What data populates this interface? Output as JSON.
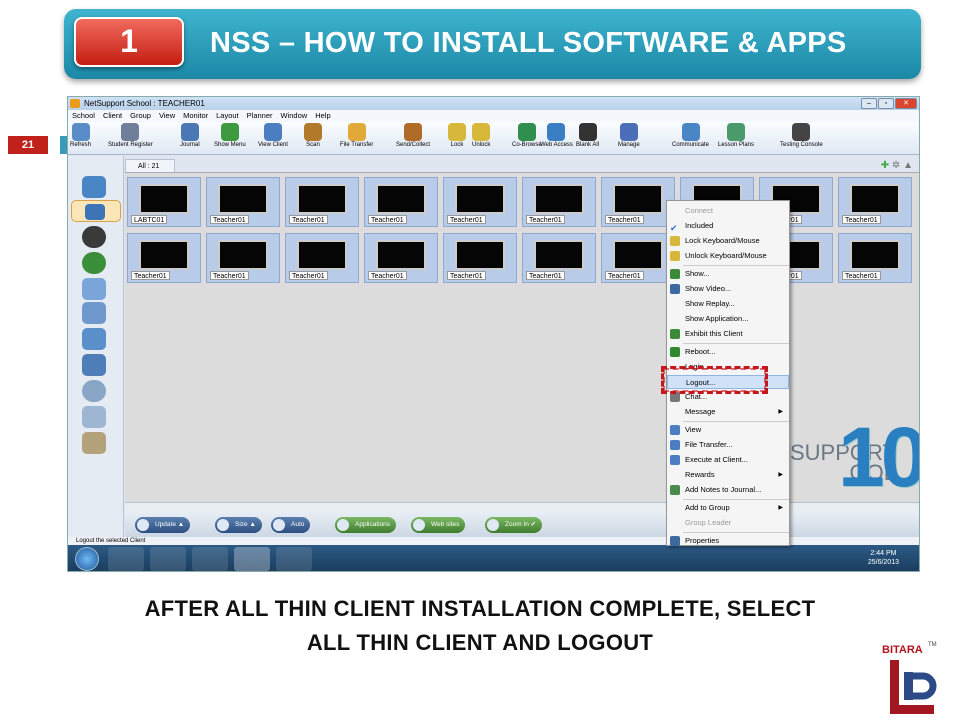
{
  "slide": {
    "number": "1",
    "title": "NSS – HOW TO INSTALL SOFTWARE & APPS",
    "page": "21",
    "caption_line1": "AFTER ALL THIN CLIENT INSTALLATION COMPLETE, SELECT",
    "caption_line2": "ALL THIN CLIENT AND LOGOUT",
    "brand": "BITARA",
    "brand_tm": "TM"
  },
  "app": {
    "title": "NetSupport School : TEACHER01",
    "menu": [
      "School",
      "Client",
      "Group",
      "View",
      "Monitor",
      "Layout",
      "Planner",
      "Window",
      "Help"
    ],
    "toolbar": [
      "Refresh",
      "Student Register",
      "Journal",
      "Show Menu",
      "View Client",
      "Scan",
      "File Transfer",
      "Send/Collect",
      "Lock",
      "Unlock",
      "Co-Browse",
      "Web Access",
      "Blank All",
      "Manage",
      "Communicate",
      "Lesson Plans",
      "Testing Console"
    ],
    "tab": "All : 21",
    "clients_row1": [
      "LABTC01",
      "Teacher01",
      "Teacher01",
      "Teacher01",
      "Teacher01",
      "Teacher01",
      "Teacher01",
      "Teacher01",
      "Teacher01",
      "Teacher01"
    ],
    "clients_row2": [
      "Teacher01",
      "Teacher01",
      "Teacher01",
      "Teacher01",
      "Teacher01",
      "Teacher01",
      "Teacher01",
      "Teacher01",
      "Teacher01",
      "Teacher01"
    ],
    "bottom_buttons": [
      "Update",
      "Size",
      "Auto",
      "Applications",
      "Web sites",
      "Zoom In"
    ],
    "status": "Logout the selected Client",
    "clock_time": "2:44 PM",
    "clock_date": "25/6/2013",
    "logo_word1": "SUPPORT",
    "logo_word2": "OOL",
    "logo_ten": "10"
  },
  "context_menu": [
    {
      "label": "Connect",
      "disabled": true
    },
    {
      "label": "Included",
      "check": true
    },
    {
      "label": "Lock Keyboard/Mouse"
    },
    {
      "label": "Unlock Keyboard/Mouse"
    },
    {
      "label": "Show..."
    },
    {
      "label": "Show Video..."
    },
    {
      "label": "Show Replay..."
    },
    {
      "label": "Show Application..."
    },
    {
      "label": "Exhibit this Client"
    },
    {
      "label": "Reboot..."
    },
    {
      "label": "Login..."
    },
    {
      "label": "Logout...",
      "highlighted": true
    },
    {
      "label": "Chat..."
    },
    {
      "label": "Message",
      "submenu": true
    },
    {
      "label": "View"
    },
    {
      "label": "File Transfer..."
    },
    {
      "label": "Execute at Client..."
    },
    {
      "label": "Rewards",
      "submenu": true
    },
    {
      "label": "Add Notes to Journal..."
    },
    {
      "label": "Add to Group",
      "submenu": true
    },
    {
      "label": "Group Leader",
      "disabled": true
    },
    {
      "label": "Properties"
    }
  ],
  "colors": {
    "accent": "#2a8fb0",
    "badge": "#d22b1f",
    "highlight": "#c4161c"
  }
}
